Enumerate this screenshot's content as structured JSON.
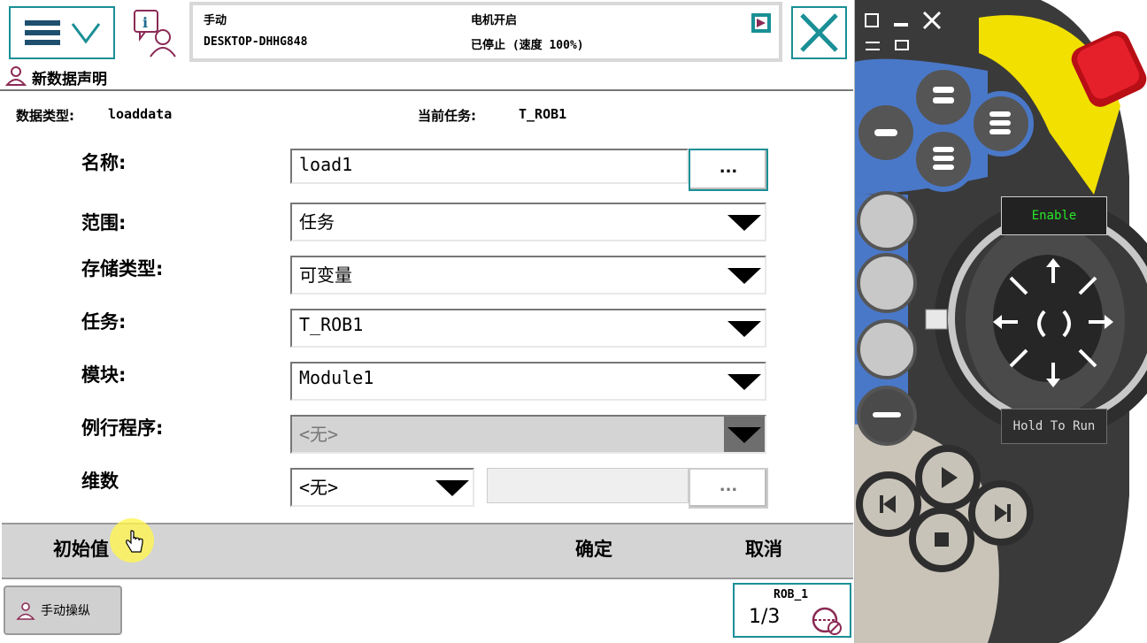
{
  "status": {
    "mode": "手动",
    "controller": "DESKTOP-DHHG848",
    "motor": "电机开启",
    "state": "已停止 (速度 100%)"
  },
  "page": {
    "title": "新数据声明",
    "data_type_label": "数据类型:",
    "data_type_value": "loaddata",
    "current_task_label": "当前任务:",
    "current_task_value": "T_ROB1"
  },
  "form": {
    "name_label": "名称:",
    "name_value": "load1",
    "name_button": "...",
    "scope_label": "范围:",
    "scope_value": "任务",
    "storage_label": "存储类型:",
    "storage_value": "可变量",
    "task_label": "任务:",
    "task_value": "T_ROB1",
    "module_label": "模块:",
    "module_value": "Module1",
    "routine_label": "例行程序:",
    "routine_value": "<无>",
    "dimension_label": "维数",
    "dimension_value": "<无>",
    "dimension_button": "..."
  },
  "actions": {
    "initial_value": "初始值",
    "ok": "确定",
    "cancel": "取消"
  },
  "taskbar": {
    "jog_label": "手动操纵",
    "rob_label": "ROB_1",
    "rob_fraction": "1/3"
  },
  "jog_device": {
    "enable_label": "Enable",
    "hold_label": "Hold To Run"
  },
  "colors": {
    "accent": "#1a8f96",
    "panel_blue": "#4a78c8",
    "emergency_red": "#d8141e",
    "enable_yellow": "#f1e000"
  }
}
